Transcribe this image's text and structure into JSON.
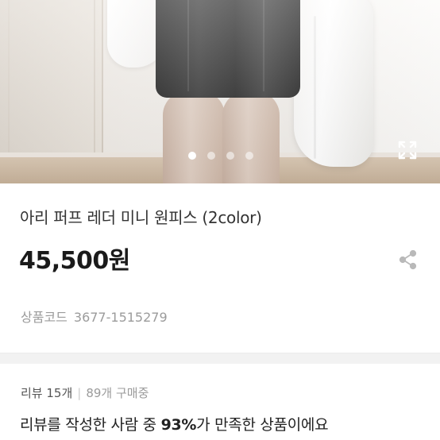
{
  "gallery": {
    "dot_count": 4,
    "active_index": 0,
    "expand_icon": "expand-icon"
  },
  "product": {
    "name": "아리 퍼프 레더 미니 원피스 (2color)",
    "price": "45,500원",
    "share_icon": "share-icon",
    "code_label": "상품코드",
    "code_value": "3677-1515279"
  },
  "reviews": {
    "count_label": "리뷰 15개",
    "purchase_label": "89개 구매중",
    "summary_prefix": "리뷰를 작성한 사람 중 ",
    "summary_percent": "93%",
    "summary_suffix": "가 만족한 상품이에요"
  },
  "colors": {
    "price": "#1a1a1a",
    "muted": "#9b9b9b",
    "divider": "#f2f2f2"
  }
}
